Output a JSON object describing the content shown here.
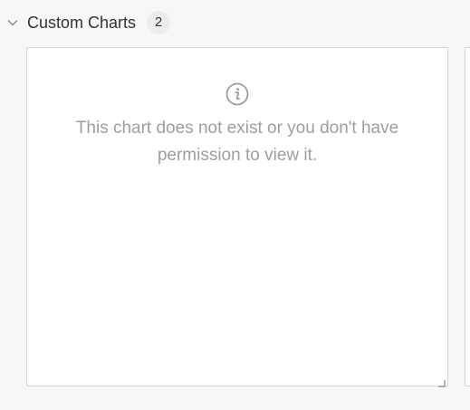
{
  "section": {
    "title": "Custom Charts",
    "count": "2"
  },
  "chart_card": {
    "message": "This chart does not exist or you don't have permission to view it.",
    "icon": "info-icon"
  },
  "icons": {
    "collapse": "chevron-down-icon",
    "resize": "resize-handle-icon"
  },
  "colors": {
    "background": "#f7f7f7",
    "card_background": "#ffffff",
    "card_border": "#d4d4d4",
    "message_text": "#9e9e9e",
    "title_text": "#333333",
    "badge_background": "#ececec"
  }
}
